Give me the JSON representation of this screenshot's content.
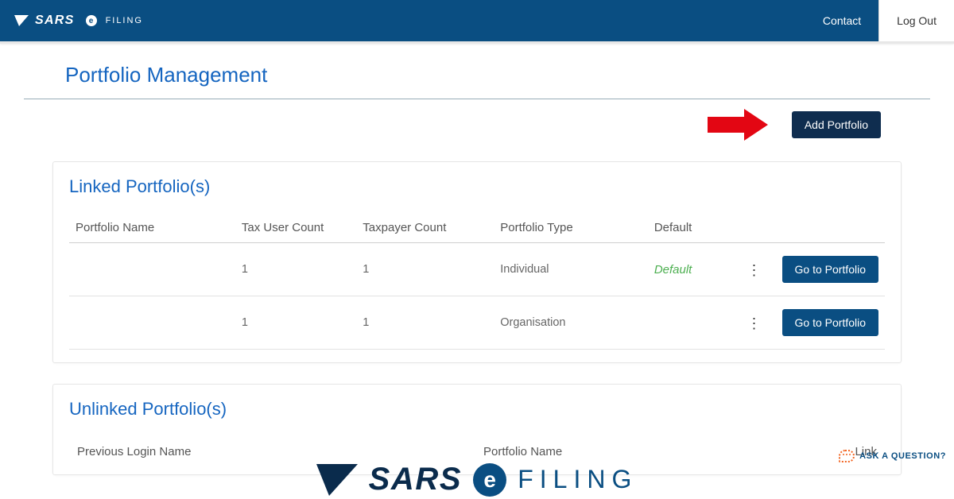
{
  "header": {
    "brand_sars": "SARS",
    "brand_e": "e",
    "brand_filing": "FILING",
    "contact": "Contact",
    "logout": "Log Out"
  },
  "page": {
    "title": "Portfolio Management"
  },
  "buttons": {
    "add_portfolio": "Add Portfolio",
    "go_to_portfolio": "Go to Portfolio"
  },
  "linked": {
    "title": "Linked Portfolio(s)",
    "columns": {
      "portfolio_name": "Portfolio Name",
      "tax_user_count": "Tax User Count",
      "taxpayer_count": "Taxpayer Count",
      "portfolio_type": "Portfolio Type",
      "default": "Default"
    },
    "rows": [
      {
        "name": "",
        "tax_user_count": "1",
        "taxpayer_count": "1",
        "type": "Individual",
        "default": "Default"
      },
      {
        "name": "",
        "tax_user_count": "1",
        "taxpayer_count": "1",
        "type": "Organisation",
        "default": ""
      }
    ]
  },
  "unlinked": {
    "title": "Unlinked Portfolio(s)",
    "columns": {
      "previous_login_name": "Previous Login Name",
      "portfolio_name": "Portfolio Name",
      "link": "Link"
    }
  },
  "ask": {
    "label": "ASK A QUESTION?"
  },
  "footer": {
    "sars": "SARS",
    "e": "e",
    "filing": "FILING"
  }
}
